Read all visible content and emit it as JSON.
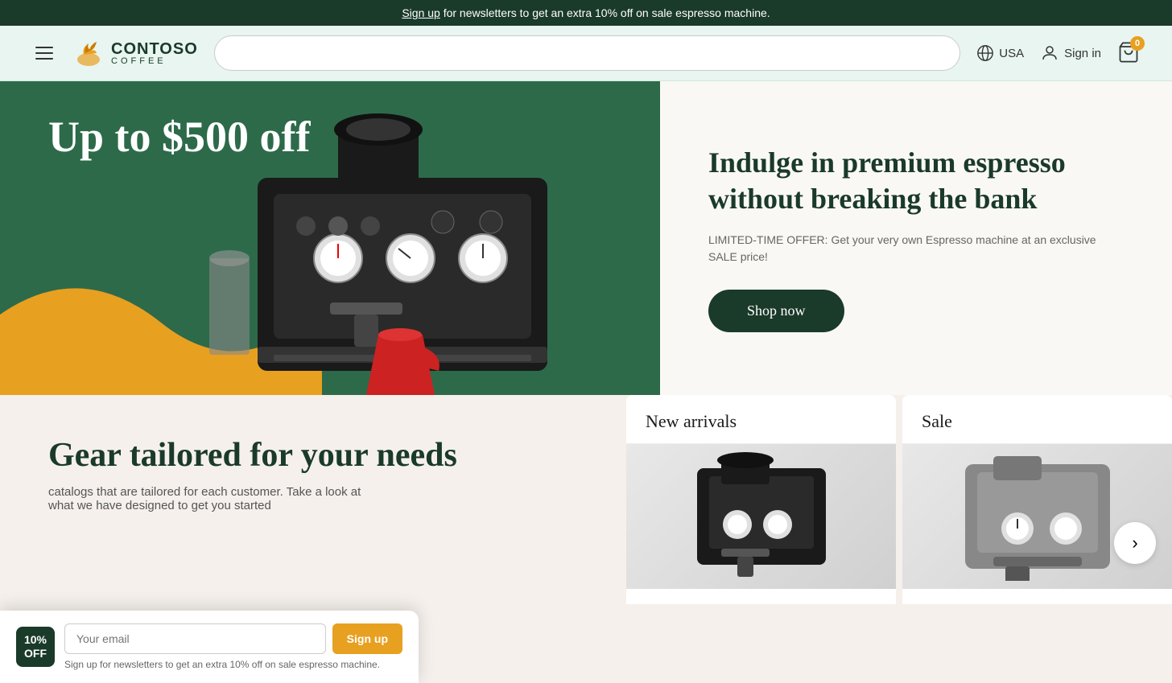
{
  "topBanner": {
    "signupText": "Sign up",
    "bannerText": " for newsletters to get an extra 10% off on sale espresso machine."
  },
  "header": {
    "logoName": "CONTOSO",
    "logoSub": "COFFEE",
    "searchPlaceholder": "",
    "region": "USA",
    "signinLabel": "Sign in",
    "cartCount": "0"
  },
  "hero": {
    "discountText": "Up to $500 off",
    "heading": "Indulge in premium espresso without breaking the bank",
    "offerText": "LIMITED-TIME OFFER: Get your very own Espresso machine at an exclusive SALE price!",
    "shopNowLabel": "Shop now"
  },
  "sections": {
    "gearHeading": "Gear tailored for your needs",
    "gearText": "catalogs that are tailored for each customer. Take a look at what we have designed to get you started",
    "newArrivalsLabel": "New arrivals",
    "saleLabel": "Sale"
  },
  "newsletter": {
    "badgeLine1": "10%",
    "badgeLine2": "OFF",
    "emailPlaceholder": "Your email",
    "signupBtn": "Sign up",
    "noteText": "Sign up for newsletters to get an extra 10% off on sale espresso machine."
  },
  "icons": {
    "hamburger": "☰",
    "globe": "🌐",
    "user": "👤",
    "cart": "🛒",
    "chevronRight": "›"
  }
}
